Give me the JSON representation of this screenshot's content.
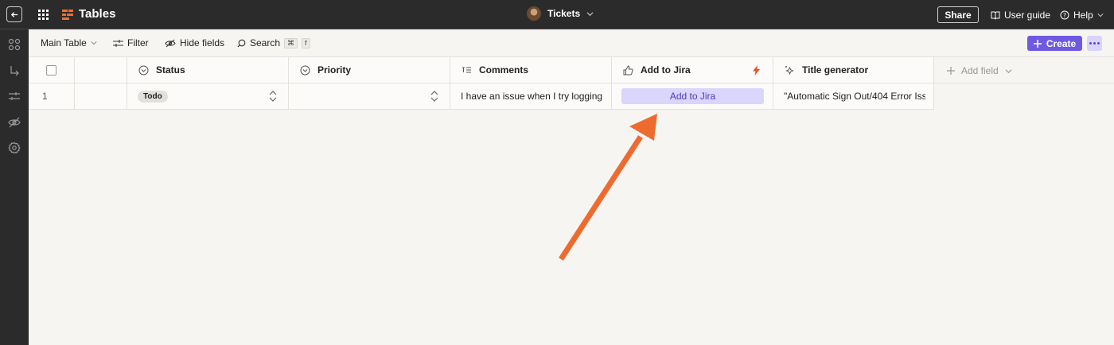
{
  "app": {
    "title": "Tables"
  },
  "header": {
    "table_name": "Tickets",
    "share_label": "Share",
    "user_guide_label": "User guide",
    "help_label": "Help"
  },
  "toolbar": {
    "view_label": "Main Table",
    "filter_label": "Filter",
    "hide_fields_label": "Hide fields",
    "search_label": "Search",
    "search_shortcut_cmd": "⌘",
    "search_shortcut_key": "f",
    "create_label": "Create"
  },
  "columns": [
    {
      "label": "Status",
      "icon": "status-dropdown-icon"
    },
    {
      "label": "Priority",
      "icon": "priority-dropdown-icon"
    },
    {
      "label": "Comments",
      "icon": "long-text-icon"
    },
    {
      "label": "Add to Jira",
      "icon": "thumbs-up-icon"
    },
    {
      "label": "Title generator",
      "icon": "ai-sparkle-icon"
    }
  ],
  "add_field_label": "Add field",
  "rows": [
    {
      "number": "1",
      "status": "Todo",
      "priority": "",
      "comments": "I have an issue when I try logging ...",
      "jira_button": "Add to Jira",
      "title": "\"Automatic Sign Out/404 Error Iss..."
    }
  ],
  "colors": {
    "accent": "#6e5ae0",
    "arrow": "#ee6b2f",
    "bolt": "#e8502a",
    "topbar": "#2b2b2b"
  }
}
